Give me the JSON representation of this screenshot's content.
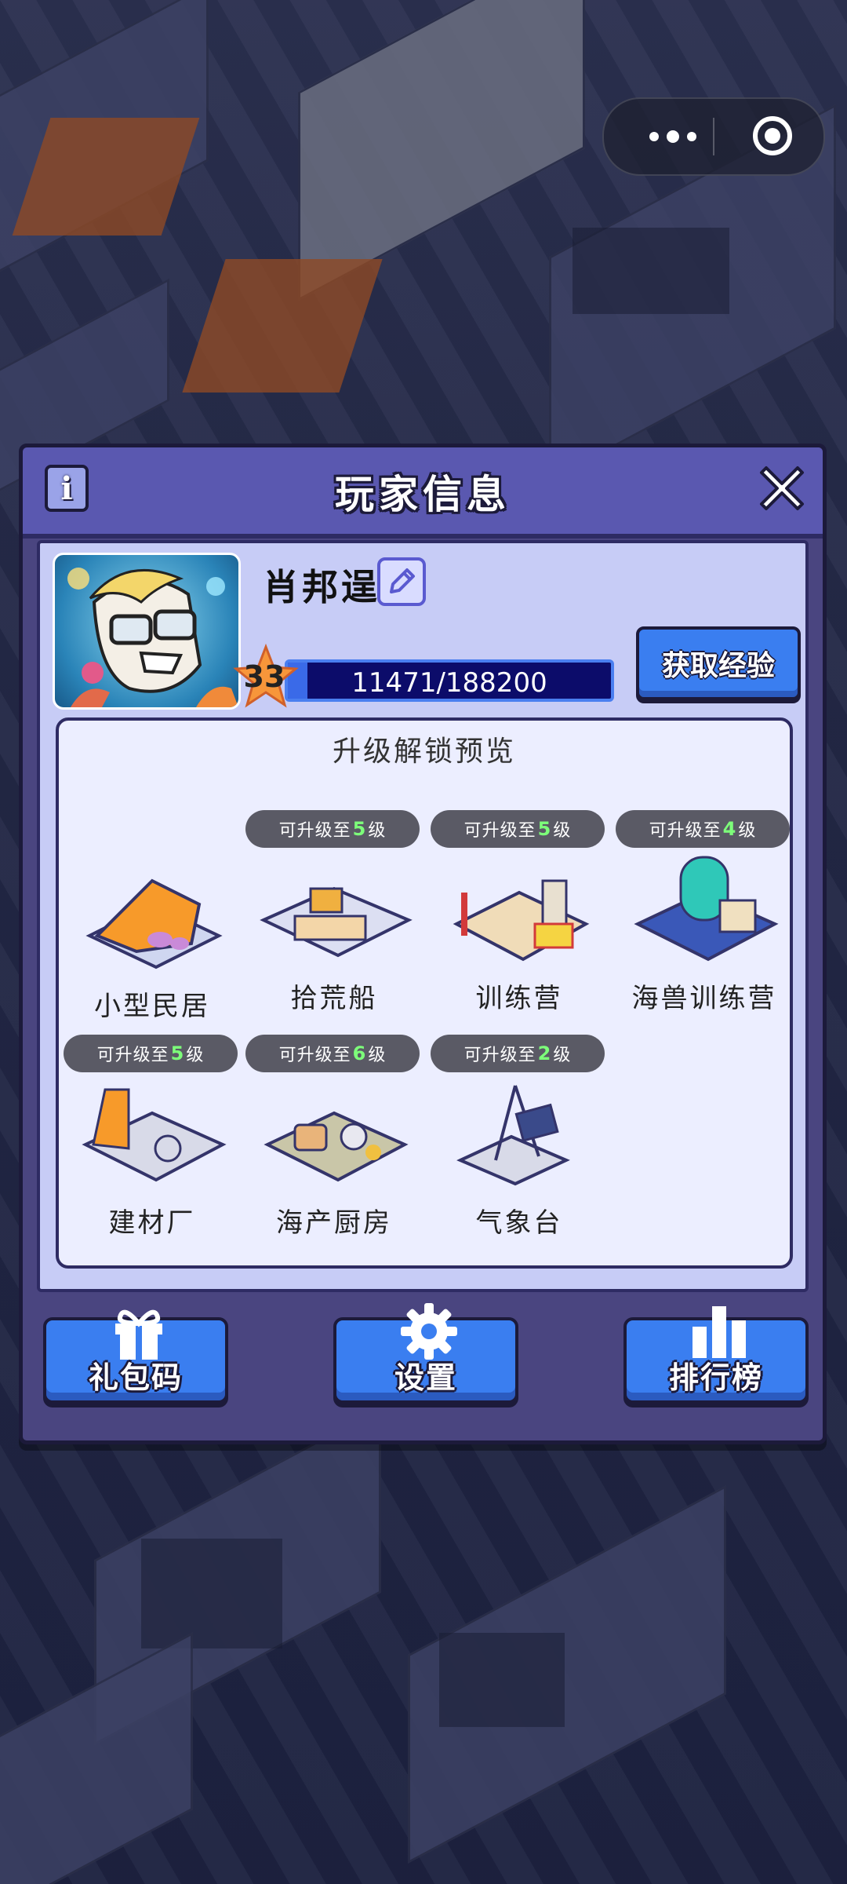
{
  "dialog": {
    "title": "玩家信息"
  },
  "player": {
    "name": "肖邦逞",
    "level": "33",
    "xp_text": "11471/188200",
    "xp_fraction": 0.061,
    "gain_xp_label": "获取经验"
  },
  "preview": {
    "title": "升级解锁预览",
    "tag_prefix": "可升级至",
    "tag_suffix": "级",
    "buildings": [
      {
        "name": "小型民居",
        "upgrade_level": ""
      },
      {
        "name": "拾荒船",
        "upgrade_level": "5"
      },
      {
        "name": "训练营",
        "upgrade_level": "5"
      },
      {
        "name": "海兽训练营",
        "upgrade_level": "4"
      },
      {
        "name": "建材厂",
        "upgrade_level": "5"
      },
      {
        "name": "海产厨房",
        "upgrade_level": "6"
      },
      {
        "name": "气象台",
        "upgrade_level": "2"
      }
    ]
  },
  "buttons": {
    "gift_code": "礼包码",
    "settings": "设置",
    "leaderboard": "排行榜"
  },
  "icons": {
    "info": "i",
    "close": "close-icon",
    "edit": "pencil-icon",
    "gift": "gift-icon",
    "settings": "gear-icon",
    "leaderboard": "bar-chart-icon"
  },
  "colors": {
    "dialog_bg": "#4a4580",
    "header_bg": "#5a58b0",
    "button_blue": "#3a7ef0",
    "level_highlight": "#7dff7a"
  }
}
